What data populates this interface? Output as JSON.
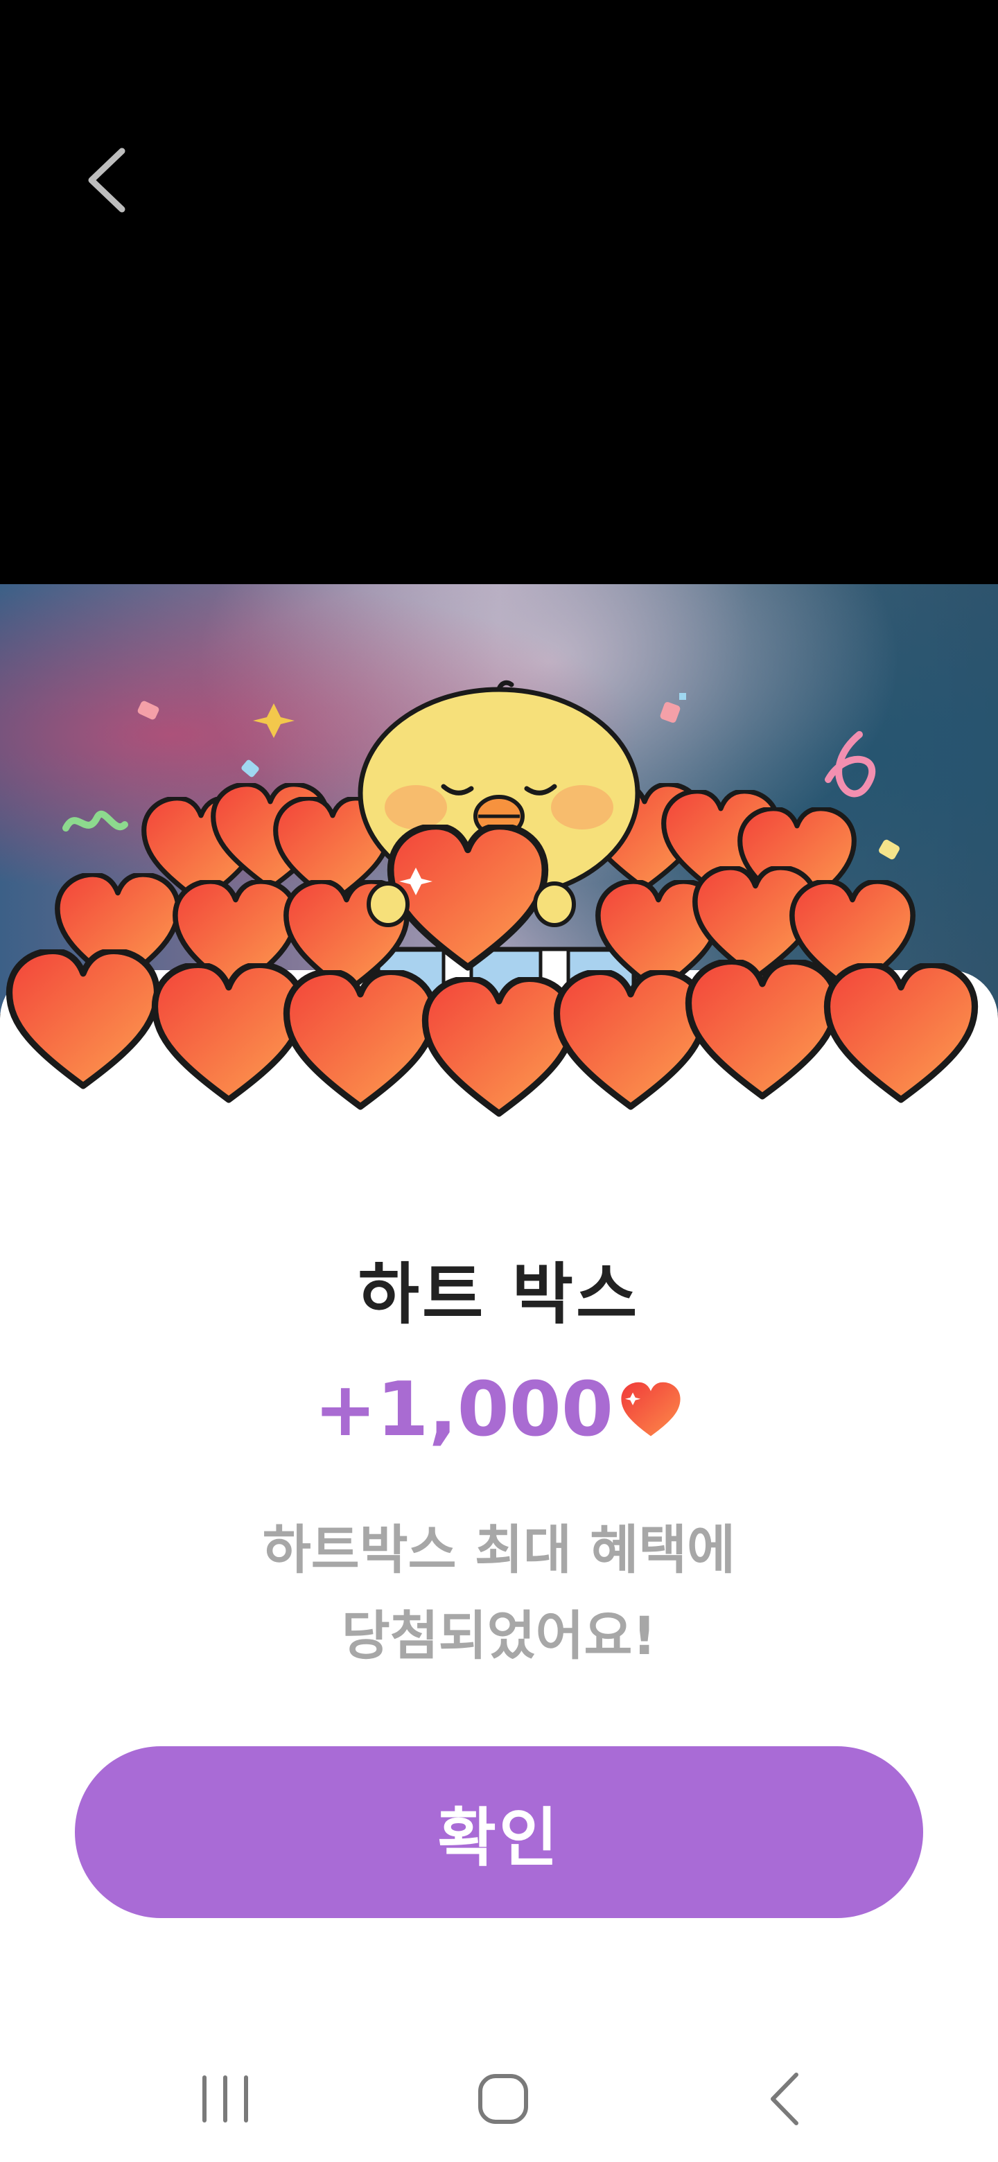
{
  "header": {
    "back_icon": "chevron-left-icon"
  },
  "popup": {
    "title": "하트 박스",
    "amount": "+1,000",
    "amount_icon": "heart-icon",
    "message_line1": "하트박스 최대 혜택에",
    "message_line2": "당첨되었어요!",
    "confirm_label": "확인"
  },
  "colors": {
    "accent_purple": "#a96bd6",
    "amount_purple": "#a96bd2",
    "heart_red": "#f2553f",
    "heart_orange": "#fc8b47",
    "chick_yellow": "#f6e07a",
    "message_gray": "#a7a7a7",
    "title_dark": "#222222"
  },
  "nav_bar": {
    "recent_icon": "recent-apps-icon",
    "home_icon": "home-icon",
    "back_icon": "back-icon"
  }
}
